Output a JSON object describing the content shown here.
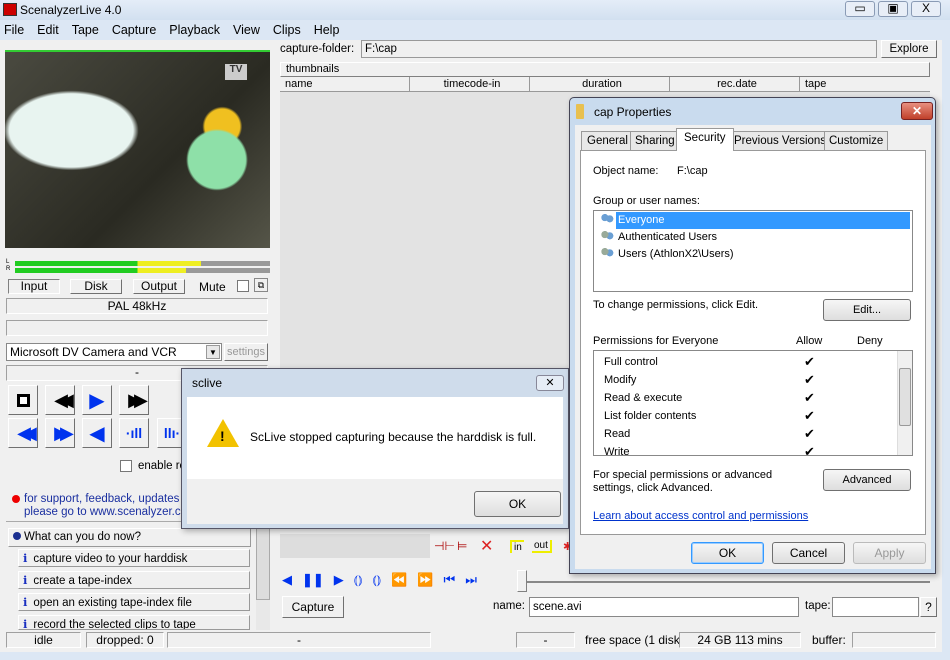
{
  "app": {
    "title": "ScenalyzerLive 4.0"
  },
  "menu": [
    "File",
    "Edit",
    "Tape",
    "Capture",
    "Playback",
    "View",
    "Clips",
    "Help"
  ],
  "monitor": {
    "buttons": [
      "Input",
      "Disk",
      "Output"
    ],
    "mute_label": "Mute",
    "format": "PAL 48kHz",
    "device": "Microsoft DV Camera and VCR",
    "settings_label": "settings",
    "status_dash": "-",
    "enable_label": "enable re"
  },
  "support": {
    "line1": "for support, feedback, updates ar",
    "line2": "please go to www.scenalyzer.com"
  },
  "help": {
    "title": "What can you do now?",
    "items": [
      "capture video to your harddisk",
      "create a tape-index",
      "open an existing tape-index file",
      "record the selected clips to tape"
    ]
  },
  "capture_folder": {
    "label": "capture-folder:",
    "value": "F:\\cap",
    "explore_label": "Explore"
  },
  "thumbnails_label": "thumbnails",
  "columns": [
    "name",
    "timecode-in",
    "duration",
    "rec.date",
    "tape"
  ],
  "edit_toolbar": {
    "in": "in",
    "out": "out"
  },
  "bottom": {
    "capture_label": "Capture",
    "name_label": "name:",
    "name_value": "scene.avi",
    "tape_label": "tape:",
    "tape_value": "",
    "help_label": "?"
  },
  "status": {
    "state": "idle",
    "dropped": "dropped: 0",
    "mid": "-",
    "dash2": "-",
    "free_label": "free space (1 disk):",
    "free_value": "24 GB 113 mins",
    "buffer_label": "buffer:"
  },
  "sclive": {
    "title": "sclive",
    "message": "ScLive stopped capturing because the harddisk is full.",
    "ok": "OK"
  },
  "props": {
    "title": "cap Properties",
    "tabs": [
      "General",
      "Sharing",
      "Security",
      "Previous Versions",
      "Customize"
    ],
    "active_tab": "Security",
    "object_label": "Object name:",
    "object_value": "F:\\cap",
    "group_label": "Group or user names:",
    "users": [
      "Everyone",
      "Authenticated Users",
      "Users (AthlonX2\\Users)"
    ],
    "selected_user": "Everyone",
    "change_text": "To change permissions, click Edit.",
    "edit_label": "Edit...",
    "perm_header": "Permissions for Everyone",
    "allow": "Allow",
    "deny": "Deny",
    "permissions": [
      {
        "name": "Full control",
        "allow": true
      },
      {
        "name": "Modify",
        "allow": true
      },
      {
        "name": "Read & execute",
        "allow": true
      },
      {
        "name": "List folder contents",
        "allow": true
      },
      {
        "name": "Read",
        "allow": true
      },
      {
        "name": "Write",
        "allow": true
      }
    ],
    "special_text": "For special permissions or advanced settings, click Advanced.",
    "advanced_label": "Advanced",
    "learn_link": "Learn about access control and permissions",
    "ok": "OK",
    "cancel": "Cancel",
    "apply": "Apply"
  },
  "colors": {
    "accent": "#3399ff",
    "transport_blue": "#0033ee",
    "link": "#0033cc",
    "selection": "#3399ff"
  }
}
